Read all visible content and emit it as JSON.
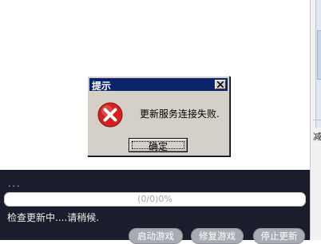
{
  "dialog": {
    "title": "提示",
    "message": "更新服务连接失败.",
    "ok_label": "确定",
    "icon": "error-icon"
  },
  "updater": {
    "dots": "...",
    "progress_text": "(0/0)0%",
    "progress_fraction": 0,
    "status": "检查更新中....请稍候.",
    "buttons": {
      "start": "启动游戏",
      "repair": "修复游戏",
      "stop": "停止更新"
    }
  },
  "right_window": {
    "partial_char": "减"
  },
  "colors": {
    "dialog_title_bg": "#0a246a",
    "dialog_bg": "#d4d0c8",
    "panel_bg": "#1c1d2c",
    "button_bg": "#a9abb2",
    "error_red": "#d42020"
  }
}
